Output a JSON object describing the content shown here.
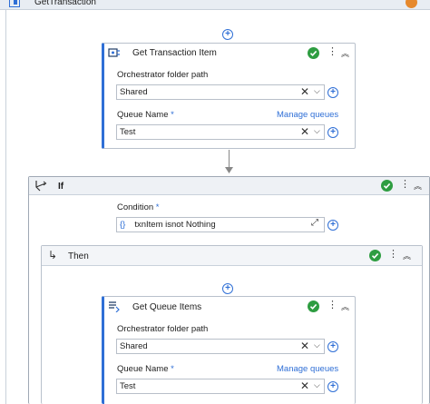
{
  "sequence": {
    "title": "GetTransaction"
  },
  "get_transaction_item": {
    "title": "Get Transaction Item",
    "folder_label": "Orchestrator folder path",
    "folder_value": "Shared",
    "queue_label": "Queue Name",
    "required_mark": "*",
    "manage_link": "Manage queues",
    "queue_value": "Test"
  },
  "if_activity": {
    "title": "If",
    "condition_label": "Condition",
    "required_mark": "*",
    "condition_prefix": "{}",
    "condition_value": "txnItem isnot Nothing"
  },
  "then_branch": {
    "title": "Then"
  },
  "get_queue_items": {
    "title": "Get Queue Items",
    "folder_label": "Orchestrator folder path",
    "folder_value": "Shared",
    "queue_label": "Queue Name",
    "required_mark": "*",
    "manage_link": "Manage queues",
    "queue_value": "Test"
  },
  "colors": {
    "accent": "#2f6fd6",
    "success": "#2e9d41",
    "warning": "#e6892d"
  },
  "icons": [
    "activity-icon",
    "check-circle-icon",
    "more-icon",
    "collapse-icon",
    "plus-circle-icon",
    "clear-icon",
    "chevron-down-icon",
    "expression-icon",
    "branch-icon",
    "then-arrow-icon"
  ]
}
